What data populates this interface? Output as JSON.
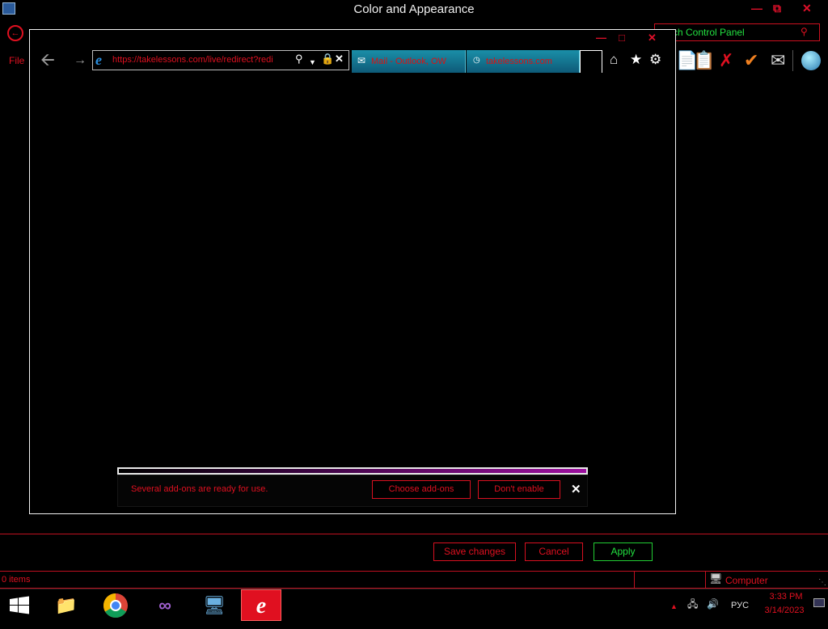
{
  "control_panel": {
    "title": "Color and Appearance",
    "search_placeholder": "Search Control Panel",
    "search_visible": "rch Control Panel",
    "menu_file": "File",
    "buttons": {
      "save": "Save changes",
      "cancel": "Cancel",
      "apply": "Apply"
    },
    "status_items": "0 items",
    "status_location": "Computer"
  },
  "browser": {
    "url": "https://takelessons.com/live/redirect?redi",
    "tabs": [
      {
        "label": "Mail - Outlook, OW"
      },
      {
        "label": "takelessons.com"
      }
    ],
    "notification": {
      "message": "Several add-ons are ready for use.",
      "choose_label": "Choose add-ons",
      "dont_enable_label": "Don't enable"
    }
  },
  "taskbar": {
    "language": "РУС",
    "time": "3:33 PM",
    "date": "3/14/2023"
  },
  "colors": {
    "accent_red": "#e01020",
    "accent_green": "#22e040",
    "progress_purple": "#9d10a0"
  }
}
